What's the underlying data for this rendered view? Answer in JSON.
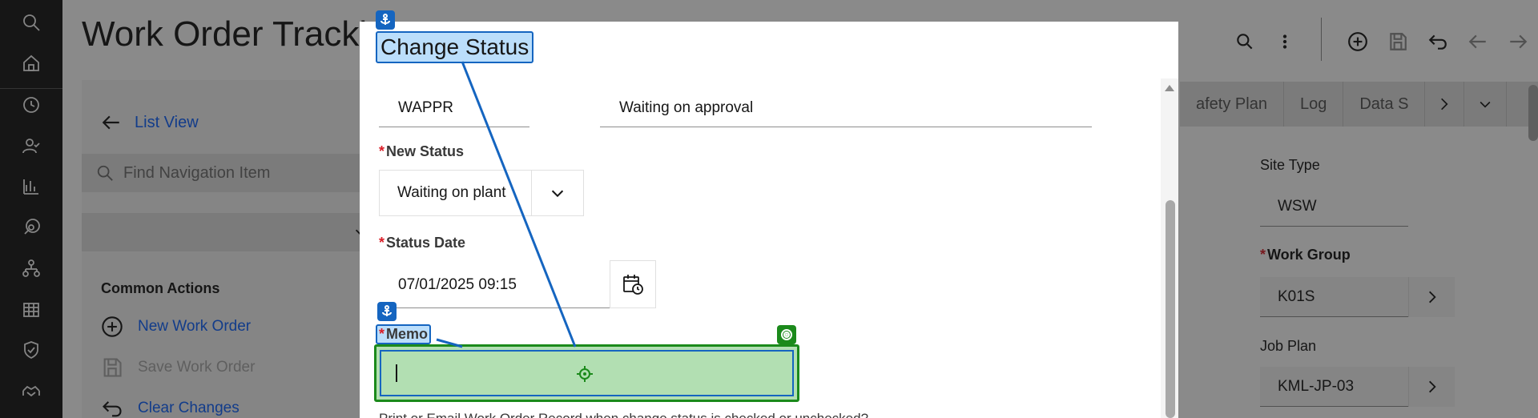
{
  "rail": {
    "icons": [
      "search-icon",
      "home-icon",
      "history-icon",
      "user-check-icon",
      "analytics-icon",
      "satellite-icon",
      "network-icon",
      "calendar-icon",
      "shield-check-icon",
      "handshake-icon"
    ]
  },
  "app": {
    "title": "Work Order Trackin",
    "toolbar": [
      "search-icon",
      "overflow-menu-icon",
      "add-icon",
      "save-icon",
      "undo-icon",
      "arrow-left-icon",
      "arrow-right-icon"
    ]
  },
  "nav": {
    "list_view": "List View",
    "search_placeholder": "Find Navigation Item",
    "common_actions_title": "Common Actions",
    "actions": [
      {
        "label": "New Work Order",
        "icon": "add-circle-icon",
        "enabled": true
      },
      {
        "label": "Save Work Order",
        "icon": "save-icon",
        "enabled": false
      },
      {
        "label": "Clear Changes",
        "icon": "undo-icon",
        "enabled": true
      }
    ]
  },
  "detail": {
    "tabs": [
      "afety Plan",
      "Log",
      "Data S"
    ],
    "site_type_label": "Site Type",
    "site_type_value": "WSW",
    "work_group_label": "Work Group",
    "work_group_value": "K01S",
    "job_plan_label": "Job Plan",
    "job_plan_value": "KML-JP-03"
  },
  "modal": {
    "title": "Change Status",
    "current_status_code": "WAPPR",
    "current_status_desc": "Waiting on approval",
    "new_status_label": "New Status",
    "new_status_value": "Waiting on plant",
    "status_date_label": "Status Date",
    "status_date_value": "07/01/2025 09:15",
    "memo_label": "Memo",
    "memo_value": "",
    "note": "Print or Email Work Order Record when change status is checked or unchecked?"
  },
  "colors": {
    "primary_link": "#0f62fe",
    "required": "#da1e28",
    "annot_blue": "#1565c0",
    "annot_green": "#1b8a1b"
  }
}
